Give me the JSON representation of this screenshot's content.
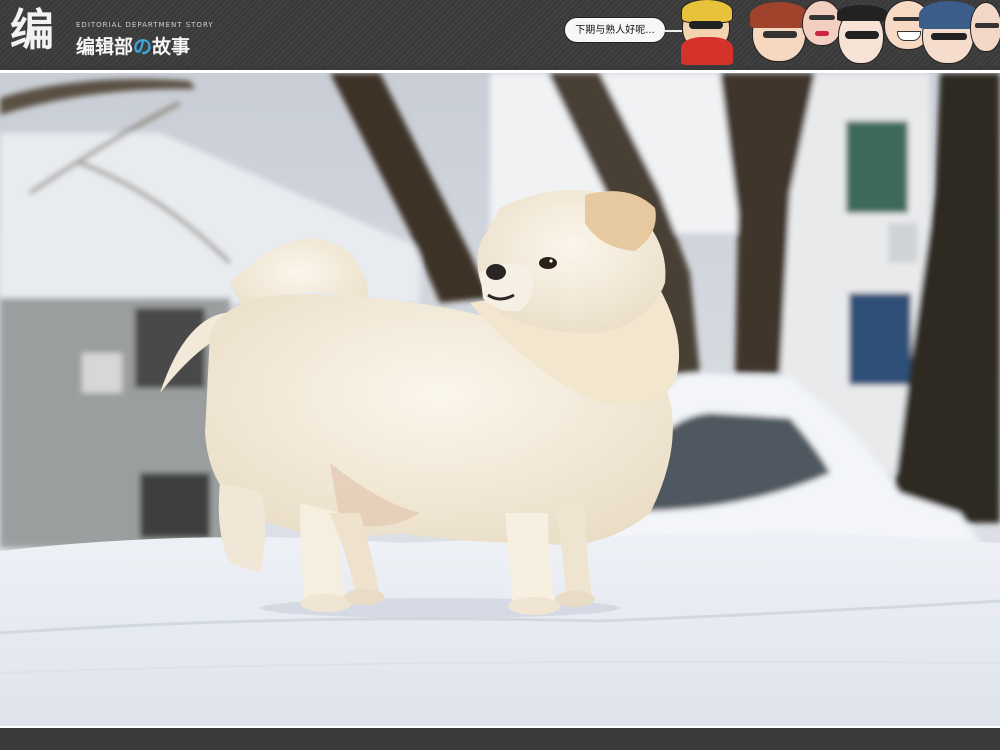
{
  "header": {
    "logo_mark": "编",
    "logo_subtitle": "EDITORIAL DEPARTMENT STORY",
    "logo_title_a": "编辑部",
    "logo_title_no": "の",
    "logo_title_b": "故事",
    "bubble_text": "下期与熟人好呢..."
  },
  "colors": {
    "header_bg": "#3b3b3b",
    "accent": "#3fa7e0",
    "snow": "#f1f3f6",
    "dog": "#f4ecdd"
  },
  "icons": [
    "logo-mark-icon",
    "character-faces-banner"
  ]
}
